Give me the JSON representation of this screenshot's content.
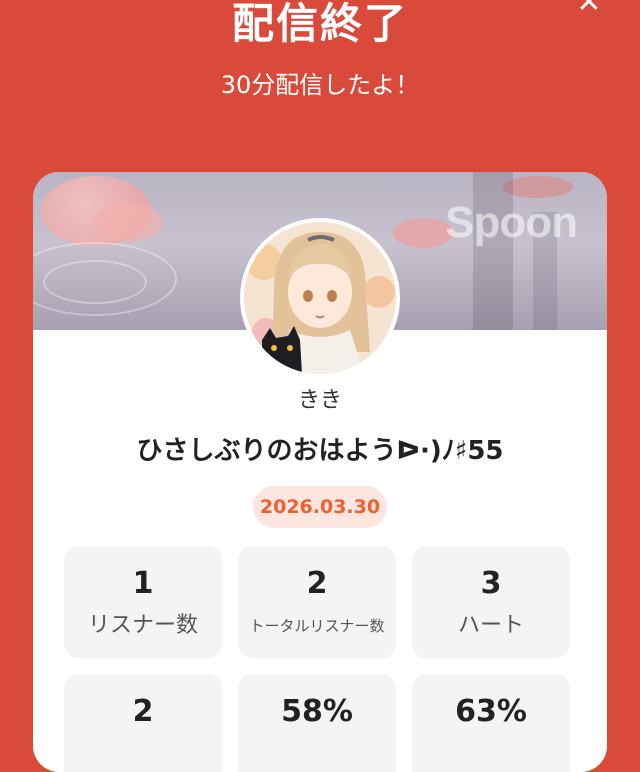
{
  "header": {
    "title": "配信終了",
    "subtitle": "30分配信したよ！",
    "close_icon": "close-icon"
  },
  "card": {
    "banner_logo": "Spoon",
    "username": "きき",
    "stream_title": "ひさしぶりのおはようᐅ·)ﾉ♯55",
    "date": "2026.03.30",
    "stats": [
      {
        "value": "1",
        "label": "リスナー数"
      },
      {
        "value": "2",
        "label": "トータルリスナー数"
      },
      {
        "value": "3",
        "label": "ハート"
      },
      {
        "value": "2",
        "label": ""
      },
      {
        "value": "58%",
        "label": ""
      },
      {
        "value": "63%",
        "label": ""
      }
    ]
  },
  "colors": {
    "background": "#d94a3b",
    "date_text": "#f0612e",
    "date_bg": "#fde6df"
  }
}
